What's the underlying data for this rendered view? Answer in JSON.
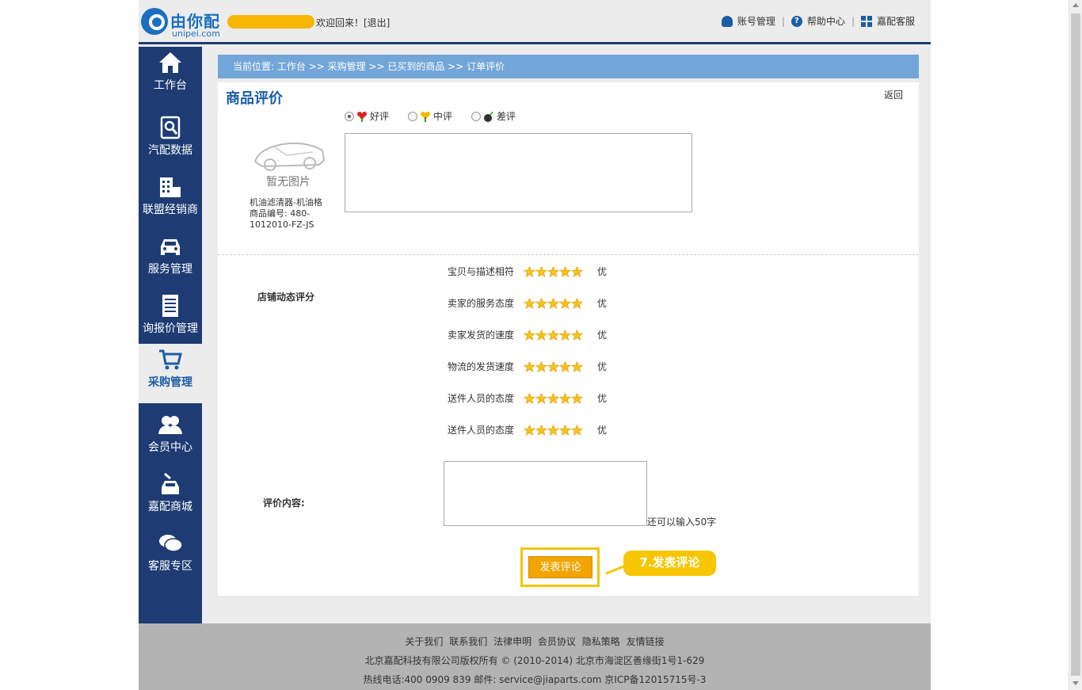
{
  "header": {
    "logo_text": "由你配",
    "logo_sub": "unipei.com",
    "welcome": "欢迎回来！[退出]",
    "links": [
      {
        "label": "账号管理",
        "icon": "user-icon"
      },
      {
        "label": "帮助中心",
        "icon": "help-icon"
      },
      {
        "label": "嘉配客服",
        "icon": "grid-icon"
      }
    ],
    "separator": "|"
  },
  "sidebar": {
    "items": [
      {
        "label": "工作台",
        "icon": "home-icon"
      },
      {
        "label": "汽配数据",
        "icon": "search-doc-icon"
      },
      {
        "label": "联盟经销商",
        "icon": "building-icon"
      },
      {
        "label": "服务管理",
        "icon": "car-icon"
      },
      {
        "label": "询报价管理",
        "icon": "document-icon"
      },
      {
        "label": "采购管理",
        "icon": "cart-icon",
        "active": true
      },
      {
        "label": "会员中心",
        "icon": "members-icon"
      },
      {
        "label": "嘉配商城",
        "icon": "shop-icon"
      },
      {
        "label": "客服专区",
        "icon": "chat-icon"
      }
    ]
  },
  "breadcrumb": "当前位置: 工作台 >> 采购管理 >> 已买到的商品 >> 订单评价",
  "panel": {
    "title": "商品评价",
    "back": "返回",
    "product": {
      "image_caption": "暂无图片",
      "name": "机油滤清器-机油格",
      "code": "商品编号: 480-1012010-FZ-JS"
    },
    "rating_options": [
      {
        "label": "好评",
        "checked": true
      },
      {
        "label": "中评",
        "checked": false
      },
      {
        "label": "差评",
        "checked": false
      }
    ],
    "shop_score_label": "店铺动态评分",
    "scores": [
      {
        "label": "宝贝与描述相符",
        "stars": 5,
        "value": "优"
      },
      {
        "label": "卖家的服务态度",
        "stars": 5,
        "value": "优"
      },
      {
        "label": "卖家发货的速度",
        "stars": 5,
        "value": "优"
      },
      {
        "label": "物流的发货速度",
        "stars": 5,
        "value": "优"
      },
      {
        "label": "送件人员的态度",
        "stars": 5,
        "value": "优"
      },
      {
        "label": "送件人员的态度",
        "stars": 5,
        "value": "优"
      }
    ],
    "comment_label": "评价内容:",
    "char_hint": "还可以输入50字",
    "submit": "发表评论",
    "callout": "7.发表评论"
  },
  "footer": {
    "links": [
      "关于我们",
      "联系我们",
      "法律申明",
      "会员协议",
      "隐私策略",
      "友情链接"
    ],
    "copyright": "北京嘉配科技有限公司版权所有 © (2010-2014) 北京市海淀区善缘街1号1-629",
    "contact": "热线电话:400 0909 839    邮件: service@jiaparts.com    京ICP备12015715号-3"
  },
  "colors": {
    "sidebar": "#1e3c73",
    "breadcrumb": "#73a6d8",
    "title": "#1a5ea8",
    "accent": "#f2a500"
  }
}
